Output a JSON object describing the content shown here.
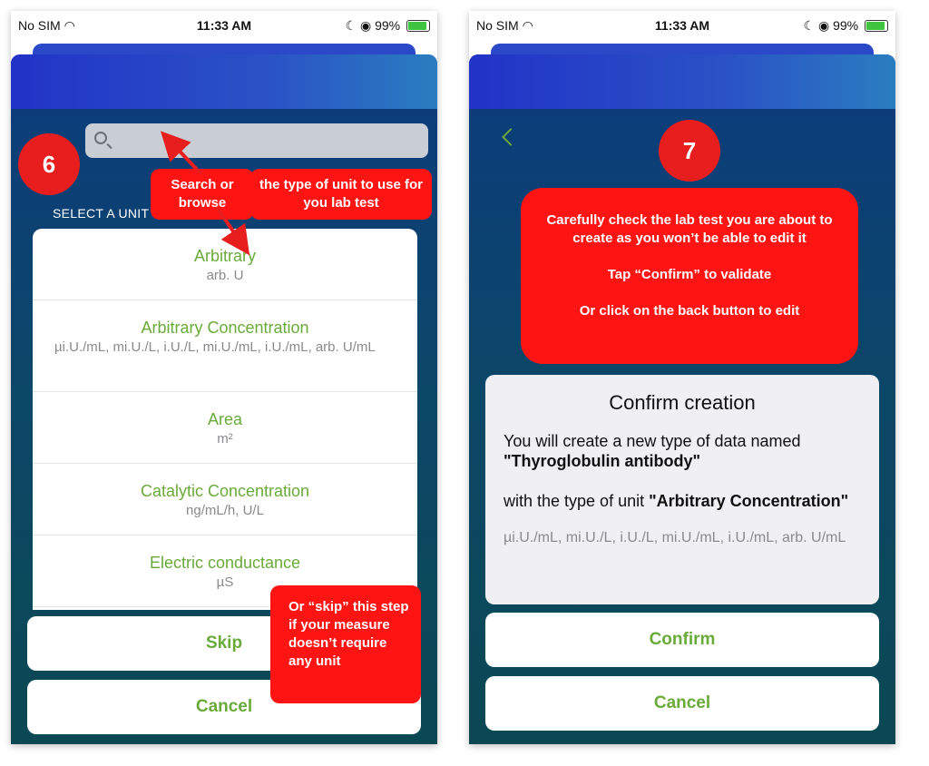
{
  "status_bar": {
    "carrier": "No SIM",
    "time": "11:33 AM",
    "battery": "99%"
  },
  "step6": {
    "badge": "6",
    "search": {
      "placeholder": ""
    },
    "section_label": "SELECT A UNIT",
    "units": [
      {
        "name": "Arbitrary",
        "units": "arb. U"
      },
      {
        "name": "Arbitrary Concentration",
        "units": "µi.U./mL, mi.U./L, i.U./L, mi.U./mL, i.U./mL, arb. U/mL"
      },
      {
        "name": "Area",
        "units": "m²"
      },
      {
        "name": "Catalytic Concentration",
        "units": "ng/mL/h, U/L"
      },
      {
        "name": "Electric conductance",
        "units": "µS"
      }
    ],
    "skip_label": "Skip",
    "cancel_label": "Cancel",
    "callout_search": "Search or browse",
    "callout_type": "the type of unit to use for you lab test",
    "callout_skip": "Or “skip” this step if your measure doesn’t require any unit"
  },
  "step7": {
    "badge": "7",
    "callout": {
      "line1": "Carefully check the lab test you are about to create as you won’t be able to edit it",
      "line2": "Tap “Confirm” to validate",
      "line3": "Or click on the back button to edit"
    },
    "card": {
      "title": "Confirm creation",
      "text1": "You will create a new type of data named",
      "data_name": "\"Thyroglobulin antibody\"",
      "text2": "with the type of unit",
      "unit_name": "\"Arbitrary Concentration\"",
      "units": "µi.U./mL, mi.U./L, i.U./L, mi.U./mL, i.U./mL, arb. U/mL"
    },
    "confirm_label": "Confirm",
    "cancel_label": "Cancel"
  },
  "colors": {
    "accent_green": "#6aaa3a",
    "callout_red": "#ff1414",
    "badge_red": "#e81d1d"
  }
}
